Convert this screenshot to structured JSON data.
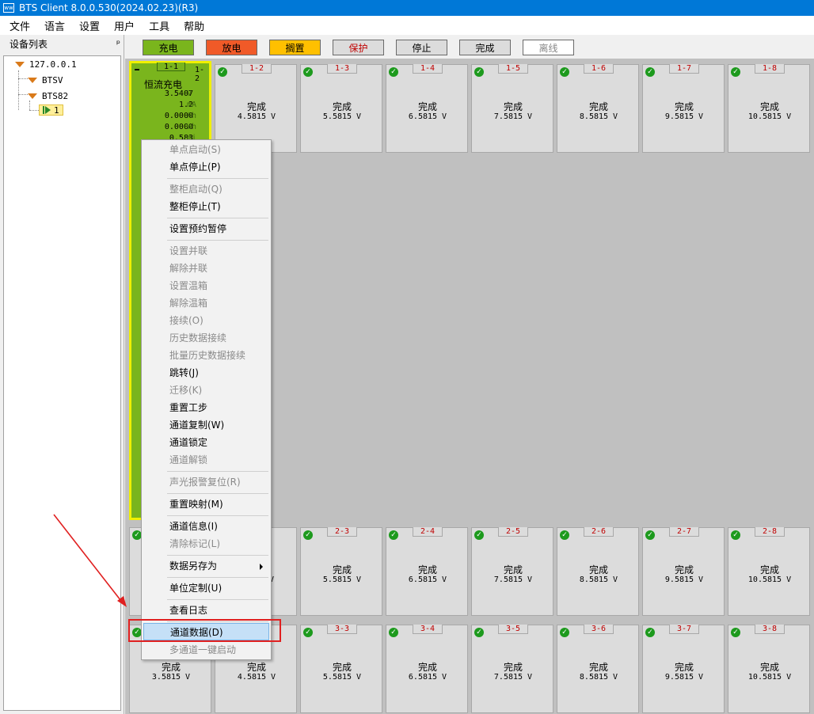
{
  "window": {
    "title": "BTS Client 8.0.0.530(2024.02.23)(R3)",
    "icon_text": "ww"
  },
  "menubar": {
    "items": [
      "文件",
      "语言",
      "设置",
      "用户",
      "工具",
      "帮助"
    ]
  },
  "left_panel": {
    "title": "设备列表",
    "pin_glyph": "ᵖ",
    "tree": {
      "root": "127.0.0.1",
      "node1": "BTSV",
      "node2": "BTS82",
      "channel": "1"
    }
  },
  "legend": {
    "items": [
      {
        "label": "充电",
        "color": "#7ab51d",
        "text_color": "#000000"
      },
      {
        "label": "放电",
        "color": "#f05a28",
        "text_color": "#000000"
      },
      {
        "label": "搁置",
        "color": "#ffc000",
        "text_color": "#000000"
      },
      {
        "label": "保护",
        "color": "#dcdcdc",
        "text_color": "#c00000"
      },
      {
        "label": "停止",
        "color": "#dcdcdc",
        "text_color": "#000000"
      },
      {
        "label": "完成",
        "color": "#dcdcdc",
        "text_color": "#000000"
      },
      {
        "label": "离线",
        "color": "#ffffff",
        "text_color": "#888888"
      }
    ]
  },
  "active_cell": {
    "tab": "1-1",
    "id": "1-2",
    "mode": "恒流充电",
    "values": [
      {
        "value": "3.5407",
        "unit": "V"
      },
      {
        "value": "1.2",
        "unit": "mA"
      },
      {
        "value": "0.0000",
        "unit": "Ah"
      },
      {
        "value": "0.0000",
        "unit": "Wh"
      },
      {
        "value": "0.583",
        "unit": "mi"
      }
    ]
  },
  "cells": {
    "row1": [
      {
        "id": "1-2",
        "status": "完成",
        "volt": "4.5815 V"
      },
      {
        "id": "1-3",
        "status": "完成",
        "volt": "5.5815 V"
      },
      {
        "id": "1-4",
        "status": "完成",
        "volt": "6.5815 V"
      },
      {
        "id": "1-5",
        "status": "完成",
        "volt": "7.5815 V"
      },
      {
        "id": "1-6",
        "status": "完成",
        "volt": "8.5815 V"
      },
      {
        "id": "1-7",
        "status": "完成",
        "volt": "9.5815 V"
      },
      {
        "id": "1-8",
        "status": "完成",
        "volt": "10.5815 V"
      }
    ],
    "row2": [
      {
        "id": "2-3",
        "status": "完成",
        "volt": "5.5815 V"
      },
      {
        "id": "2-4",
        "status": "完成",
        "volt": "6.5815 V"
      },
      {
        "id": "2-5",
        "status": "完成",
        "volt": "7.5815 V"
      },
      {
        "id": "2-6",
        "status": "完成",
        "volt": "8.5815 V"
      },
      {
        "id": "2-7",
        "status": "完成",
        "volt": "9.5815 V"
      },
      {
        "id": "2-8",
        "status": "完成",
        "volt": "10.5815 V"
      }
    ],
    "row3": [
      {
        "id": "3-3",
        "status": "完成",
        "volt": "5.5815 V"
      },
      {
        "id": "3-4",
        "status": "完成",
        "volt": "6.5815 V"
      },
      {
        "id": "3-5",
        "status": "完成",
        "volt": "7.5815 V"
      },
      {
        "id": "3-6",
        "status": "完成",
        "volt": "8.5815 V"
      },
      {
        "id": "3-7",
        "status": "完成",
        "volt": "9.5815 V"
      },
      {
        "id": "3-8",
        "status": "完成",
        "volt": "10.5815 V"
      }
    ],
    "partial": {
      "r3c1": {
        "status": "完成",
        "volt": "3.5815 V"
      },
      "r3c2": {
        "status": "完成",
        "volt": "4.5815 V"
      },
      "r2c2_unit": "V"
    }
  },
  "context_menu": {
    "items": [
      {
        "label": "单点启动(S)",
        "enabled": false
      },
      {
        "label": "单点停止(P)",
        "enabled": true
      },
      {
        "label": "整柜启动(Q)",
        "enabled": false
      },
      {
        "label": "整柜停止(T)",
        "enabled": true
      },
      {
        "label": "设置预约暂停",
        "enabled": true
      },
      {
        "label": "设置并联",
        "enabled": false
      },
      {
        "label": "解除并联",
        "enabled": false
      },
      {
        "label": "设置温箱",
        "enabled": false
      },
      {
        "label": "解除温箱",
        "enabled": false
      },
      {
        "label": "接续(O)",
        "enabled": false
      },
      {
        "label": "历史数据接续",
        "enabled": false
      },
      {
        "label": "批量历史数据接续",
        "enabled": false
      },
      {
        "label": "跳转(J)",
        "enabled": true
      },
      {
        "label": "迁移(K)",
        "enabled": false
      },
      {
        "label": "重置工步",
        "enabled": true
      },
      {
        "label": "通道复制(W)",
        "enabled": true
      },
      {
        "label": "通道锁定",
        "enabled": true
      },
      {
        "label": "通道解锁",
        "enabled": false
      },
      {
        "label": "声光报警复位(R)",
        "enabled": false
      },
      {
        "label": "重置映射(M)",
        "enabled": true
      },
      {
        "label": "通道信息(I)",
        "enabled": true
      },
      {
        "label": "清除标记(L)",
        "enabled": false
      },
      {
        "label": "数据另存为",
        "enabled": true,
        "submenu": true
      },
      {
        "label": "单位定制(U)",
        "enabled": true
      },
      {
        "label": "查看日志",
        "enabled": true
      },
      {
        "label": "通道数据(D)",
        "enabled": true,
        "selected": true
      },
      {
        "label": "多通道一键启动",
        "enabled": false
      }
    ]
  },
  "annotation": {
    "box_color": "#e02020"
  }
}
